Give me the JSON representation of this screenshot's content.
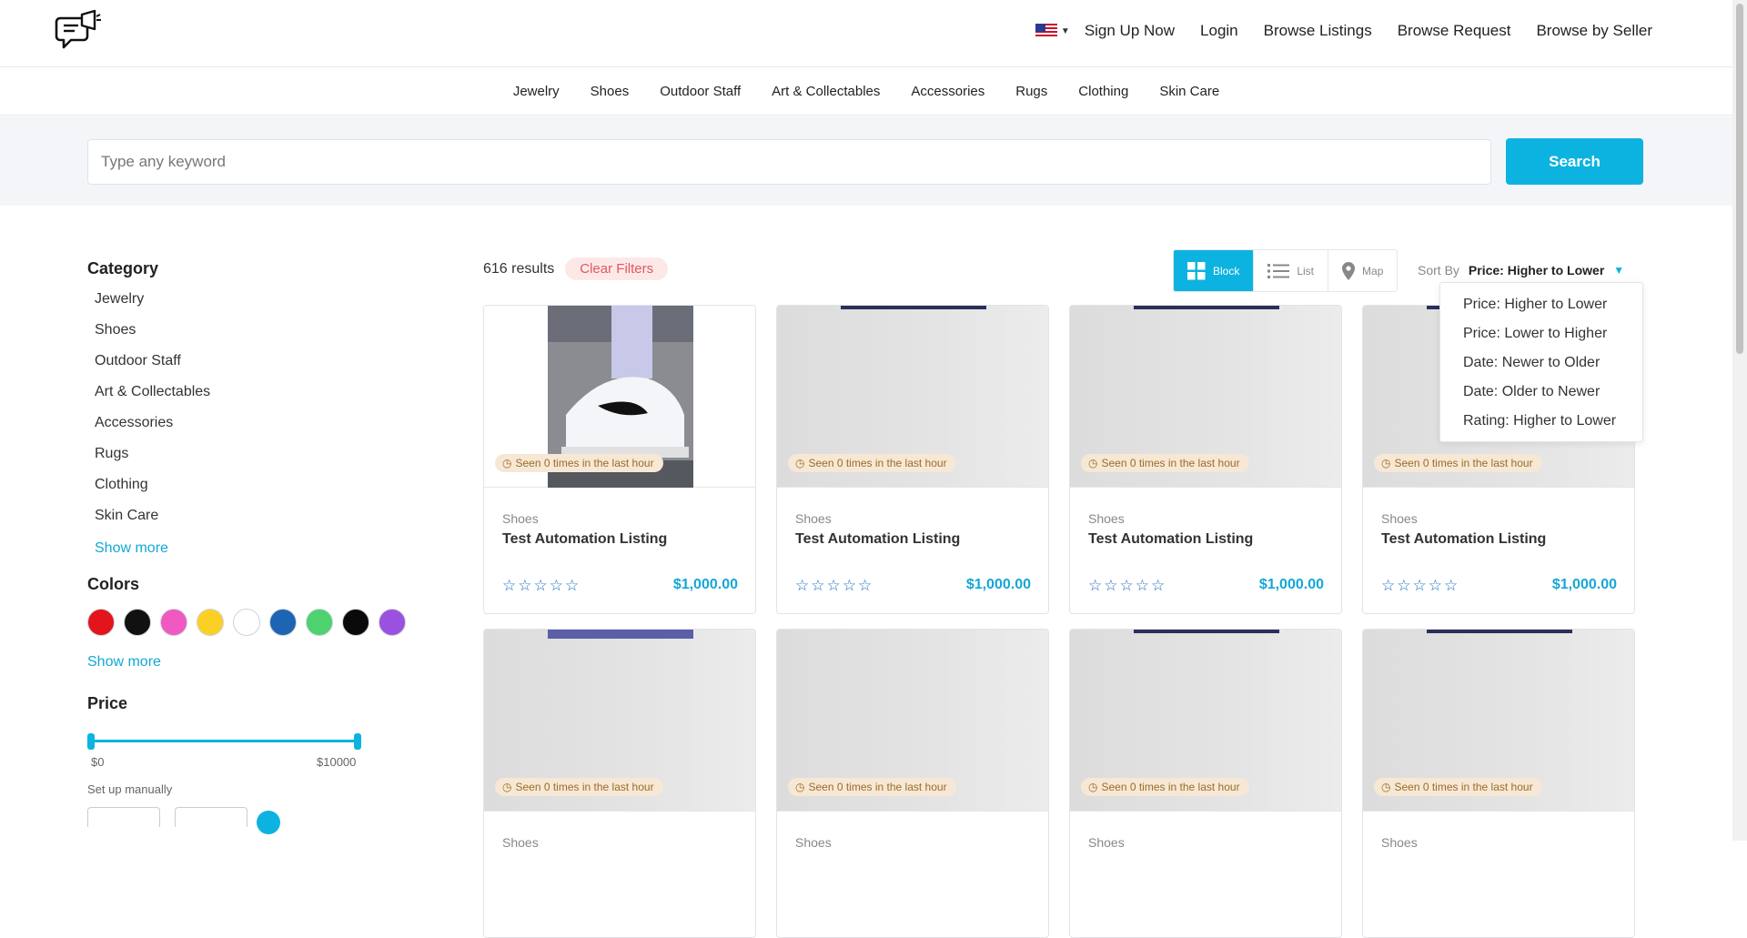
{
  "header": {
    "logo_icon": "megaphone-chat-logo",
    "flag_icon": "us-flag-icon",
    "nav": [
      "Sign Up Now",
      "Login",
      "Browse Listings",
      "Browse Request",
      "Browse by Seller"
    ]
  },
  "categories_bar": [
    "Jewelry",
    "Shoes",
    "Outdoor Staff",
    "Art & Collectables",
    "Accessories",
    "Rugs",
    "Clothing",
    "Skin Care"
  ],
  "search": {
    "placeholder": "Type any keyword",
    "button": "Search"
  },
  "sidebar": {
    "category_title": "Category",
    "categories": [
      "Jewelry",
      "Shoes",
      "Outdoor Staff",
      "Art & Collectables",
      "Accessories",
      "Rugs",
      "Clothing",
      "Skin Care"
    ],
    "categories_show_more": "Show more",
    "colors_title": "Colors",
    "colors": [
      "#e3141c",
      "#111111",
      "#f058c2",
      "#fbd025",
      "#ffffff",
      "#1d65b3",
      "#4ed26f",
      "#0a0a0a",
      "#9b51e0"
    ],
    "colors_show_more": "Show more",
    "price_title": "Price",
    "price_min": "$0",
    "price_max": "$10000",
    "manual_label": "Set up manually"
  },
  "results": {
    "count": "616 results",
    "clear_filters": "Clear Filters",
    "views": [
      "Block",
      "List",
      "Map"
    ],
    "active_view": "Block",
    "sort_label": "Sort By",
    "sort_value": "Price: Higher to Lower",
    "sort_options": [
      "Price: Higher to Lower",
      "Price: Lower to Higher",
      "Date: Newer to Older",
      "Date: Older to Newer",
      "Rating: Higher to Lower"
    ]
  },
  "listings": [
    {
      "seen": "Seen 0 times in the last hour",
      "category": "Shoes",
      "title": "Test Automation Listing",
      "price": "$1,000.00",
      "rating": 0
    },
    {
      "seen": "Seen 0 times in the last hour",
      "category": "Shoes",
      "title": "Test Automation Listing",
      "price": "$1,000.00",
      "rating": 0
    },
    {
      "seen": "Seen 0 times in the last hour",
      "category": "Shoes",
      "title": "Test Automation Listing",
      "price": "$1,000.00",
      "rating": 0
    },
    {
      "seen": "Seen 0 times in the last hour",
      "category": "Shoes",
      "title": "Test Automation Listing",
      "price": "$1,000.00",
      "rating": 0
    },
    {
      "seen": "Seen 0 times in the last hour",
      "category": "Shoes"
    },
    {
      "seen": "Seen 0 times in the last hour",
      "category": "Shoes"
    },
    {
      "seen": "Seen 0 times in the last hour",
      "category": "Shoes"
    },
    {
      "seen": "Seen 0 times in the last hour",
      "category": "Shoes"
    }
  ]
}
